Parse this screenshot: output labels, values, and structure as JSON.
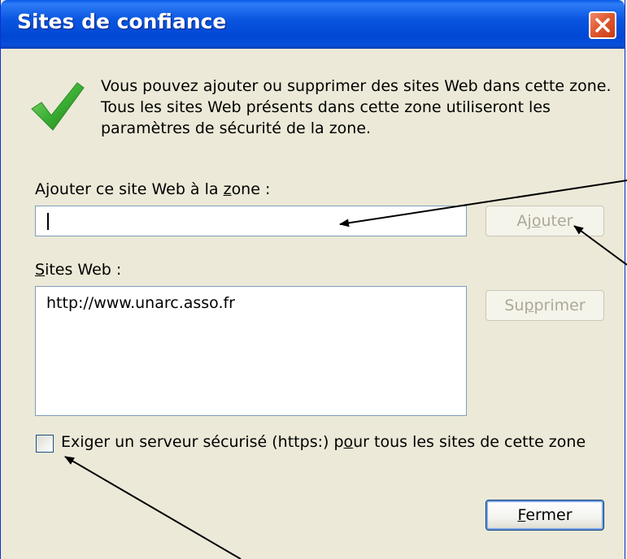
{
  "window": {
    "title": "Sites de confiance"
  },
  "info": {
    "text": "Vous pouvez ajouter ou supprimer des sites Web dans cette zone. Tous les sites Web présents dans cette zone utiliseront les paramètres de sécurité de la zone."
  },
  "add_site": {
    "label_pre": "Ajouter ce site Web à la ",
    "label_accel": "z",
    "label_post": "one :",
    "value": "",
    "button_pre": "Aj",
    "button_accel": "o",
    "button_post": "uter"
  },
  "sites": {
    "label_accel": "S",
    "label_post": "ites Web :",
    "items": [
      "http://www.unarc.asso.fr"
    ],
    "remove_pre": "Su",
    "remove_accel": "p",
    "remove_post": "primer"
  },
  "https_option": {
    "label_pre": "Exiger un serveur sécurisé (https:) p",
    "label_accel": "o",
    "label_post": "ur tous les sites de cette zone",
    "checked": false
  },
  "footer": {
    "close_accel": "F",
    "close_post": "ermer"
  },
  "icons": {
    "info": "checkmark-icon",
    "titlebar_close": "close-x-icon"
  },
  "colors": {
    "titlebar": "#0a56e0",
    "close": "#e15a32",
    "dialog_bg": "#ece9d8",
    "checkmark": "#3cb034"
  }
}
